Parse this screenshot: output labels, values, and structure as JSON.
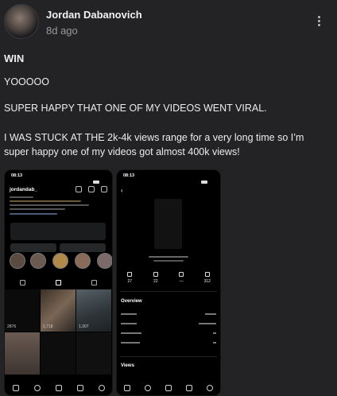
{
  "post": {
    "author": "Jordan Dabanovich",
    "time": "8d ago",
    "title": "WIN",
    "paragraphs": [
      "YOOOOO",
      "SUPER HAPPY THAT ONE OF MY VIDEOS WENT VIRAL.",
      "I WAS STUCK AT THE 2k-4k views range for a very long time so I’m",
      "super happy one of my videos got almost 400k views!"
    ]
  },
  "screenshot1": {
    "time": "08:13",
    "username": "jordandab_",
    "grid_views": [
      "2876",
      "1,718",
      "1,307"
    ]
  },
  "screenshot2": {
    "time": "08:13",
    "overview": "Overview",
    "views": "Views",
    "stats": [
      "27",
      "22",
      "—",
      "312"
    ]
  },
  "icons": {
    "more": "kebab-icon",
    "back": "chevron-left-icon"
  }
}
